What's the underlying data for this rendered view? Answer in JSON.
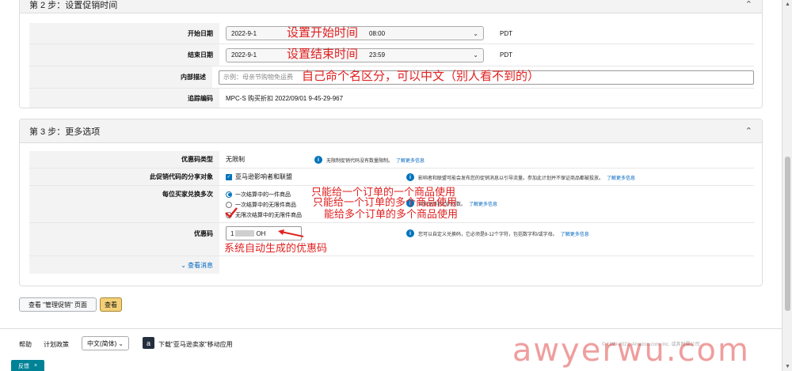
{
  "step2": {
    "title": "第 2 步：设置促销时间",
    "rows": {
      "start_label": "开始日期",
      "start_date": "2022-9-1",
      "start_time": "08:00",
      "start_tz": "PDT",
      "start_note": "设置开始时间",
      "end_label": "结束日期",
      "end_date": "2022-9-1",
      "end_time": "23:59",
      "end_tz": "PDT",
      "end_note": "设置结束时间",
      "desc_label": "内部描述",
      "desc_placeholder": "示例：母亲节购物免运费",
      "desc_note": "自己命个名区分，可以中文（别人看不到的）",
      "track_label": "追踪编码",
      "track_value": "MPC-S 购买折扣 2022/09/01 9-45-29-967"
    }
  },
  "step3": {
    "title": "第 3 步：更多选项",
    "code_type_label": "优惠码类型",
    "code_type_value": "无限制",
    "code_type_info": "无限制促销代码没有数量限制。",
    "code_type_more": "了解更多信息",
    "share_label": "此促销代码的分享对象",
    "share_option": "亚马逊影响者和联盟",
    "share_info": "影响者和联盟可能会发布您的促销消息以引导流量。参加此计划并不保证商品都被投放。",
    "share_more": "了解更多信息",
    "redeem_label": "每位买家兑换多次",
    "redeem_opt1": "一次结算中的一件商品",
    "redeem_opt2": "一次结算中的无限件商品",
    "redeem_opt3": "无限次结算中的无限件商品",
    "redeem_info": "买家兑换折扣的次数。",
    "redeem_more": "了解更多信息",
    "redeem_note1": "只能给一个订单的一个商品使用",
    "redeem_note2": "只能给一个订单的多个商品使用",
    "redeem_note3": "能给多个订单的多个商品使用",
    "coupon_label": "优惠码",
    "coupon_value": "1",
    "coupon_suffix": "OH",
    "coupon_info": "您可以自定义兑换码，它必须是8-12个字符，包括数字和/或字母。",
    "coupon_more": "了解更多信息",
    "coupon_note": "系统自动生成的优惠码",
    "view_more": "查看消息"
  },
  "buttons": {
    "view_manage": "查看 \"管理促销\" 页面",
    "view": "查看"
  },
  "footer": {
    "help": "帮助",
    "policy": "计划政策",
    "language": "中文(简体)",
    "app_download": "下载\"亚马逊卖家\"移动应用",
    "copyright": "© 1999-2022, Amazon.com, Inc. 或其附属公司",
    "feedback": "反馈",
    "watermark": "awyerwu.com"
  },
  "colors": {
    "accent": "#0073bb",
    "annotation_red": "#e02020",
    "button_yellow": "#f3d078",
    "feedback_teal": "#008296"
  }
}
